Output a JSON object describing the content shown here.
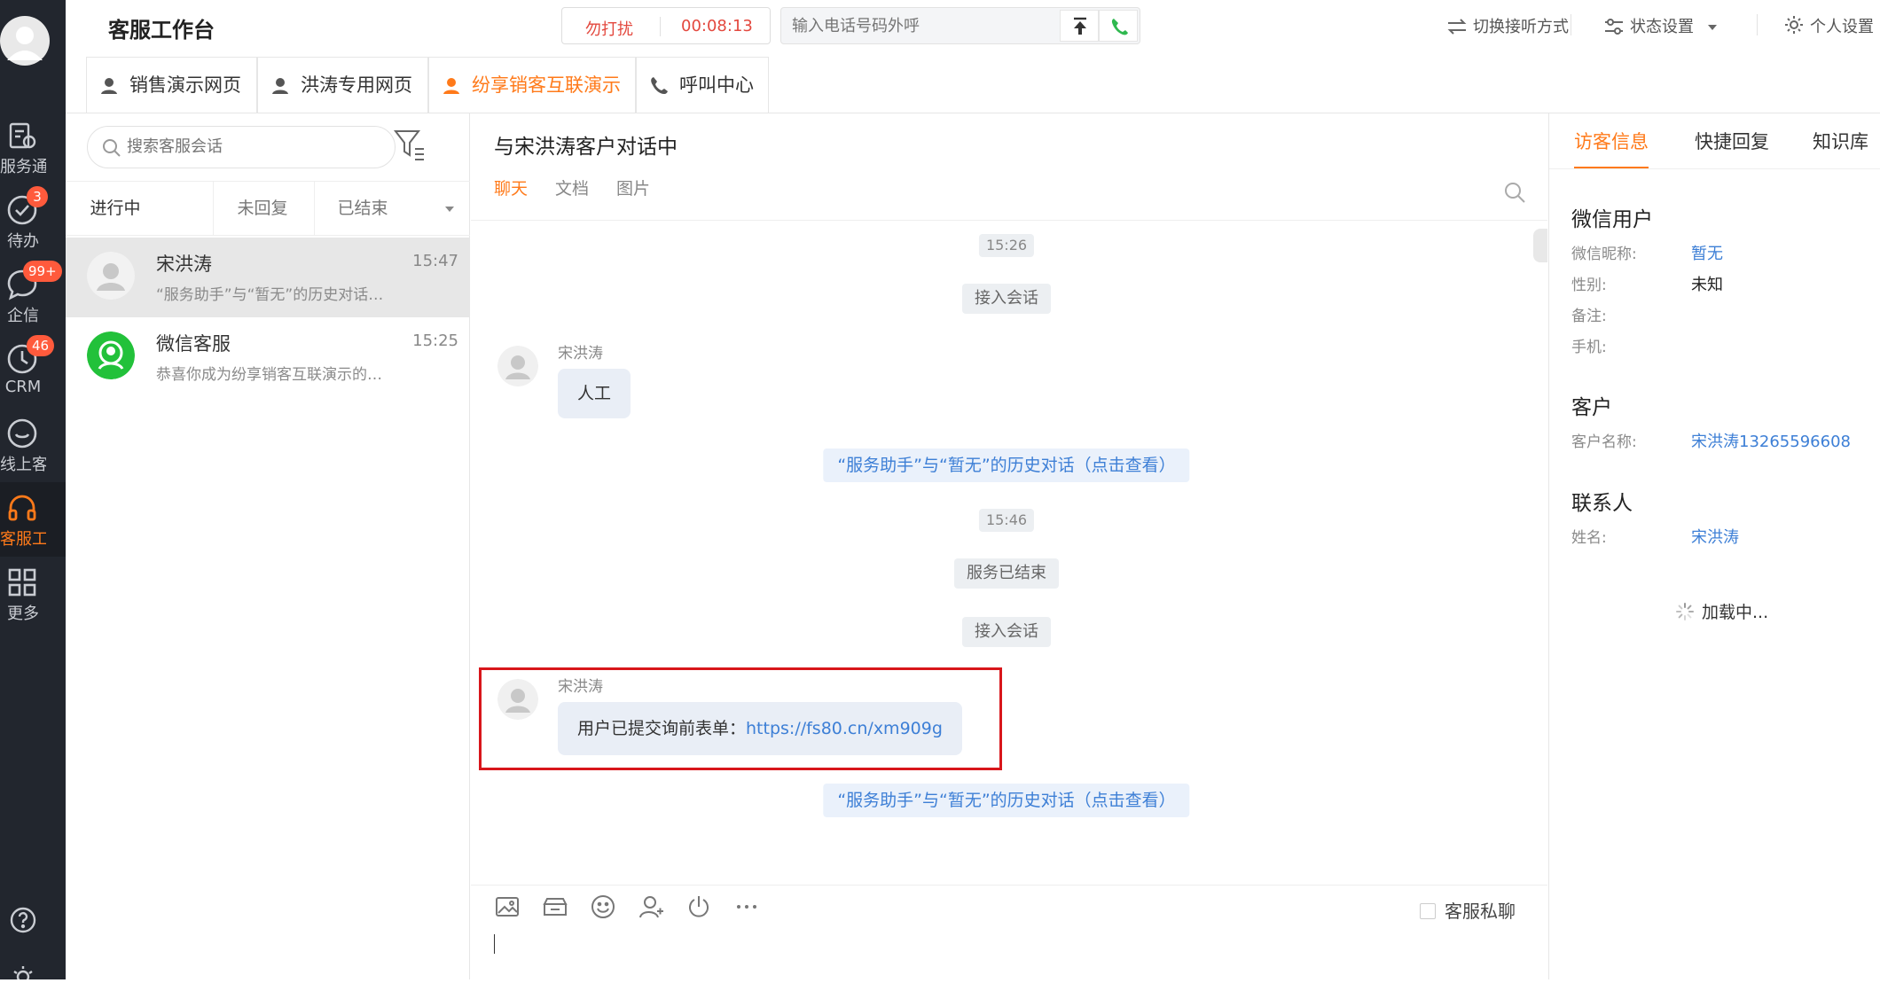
{
  "app": {
    "title": "客服工作台"
  },
  "leftnav": {
    "items": [
      {
        "label": "服务通",
        "icon": "service-icon",
        "badge": ""
      },
      {
        "label": "待办",
        "icon": "todo-check-icon",
        "badge": "3"
      },
      {
        "label": "企信",
        "icon": "chat-bubble-icon",
        "badge": "99+"
      },
      {
        "label": "CRM",
        "icon": "crm-clock-icon",
        "badge": "46"
      },
      {
        "label": "线上客服",
        "icon": "smile-chat-icon",
        "badge": ""
      },
      {
        "label": "客服工…",
        "icon": "headset-icon",
        "badge": ""
      },
      {
        "label": "更多",
        "icon": "grid-icon",
        "badge": ""
      }
    ]
  },
  "topbar": {
    "dnd_label": "勿打扰",
    "timer": "00:08:13",
    "call_placeholder": "输入电话号码外呼",
    "switch_mode": "切换接听方式",
    "status": "状态设置",
    "personal": "个人设置"
  },
  "tabs": [
    {
      "label": "销售演示网页",
      "active": false
    },
    {
      "label": "洪涛专用网页",
      "active": false
    },
    {
      "label": "纷享销客互联演示",
      "active": true
    },
    {
      "label": "呼叫中心",
      "active": false
    }
  ],
  "convlist": {
    "search_placeholder": "搜索客服会话",
    "tabs": [
      "进行中",
      "未回复",
      "已结束"
    ],
    "items": [
      {
        "name": "宋洪涛",
        "time": "15:47",
        "preview": "“服务助手”与“暂无”的历史对话（点击查看）"
      },
      {
        "name": "微信客服",
        "time": "15:25",
        "preview": "恭喜你成为纷享销客互联演示的客户"
      }
    ]
  },
  "chat": {
    "title": "与宋洪涛客户对话中",
    "tabs": [
      "聊天",
      "文档",
      "图片"
    ],
    "time1": "15:26",
    "join1": "接入会话",
    "sender": "宋洪涛",
    "msg1": "人工",
    "history_link": "“服务助手”与“暂无”的历史对话（点击查看）",
    "time2": "15:46",
    "ended": "服务已结束",
    "join2": "接入会话",
    "msg2_prefix": "用户已提交询前表单：",
    "msg2_url": "https://fs80.cn/xm909g",
    "private_chat": "客服私聊"
  },
  "right": {
    "tabs": [
      "访客信息",
      "快捷回复",
      "知识库"
    ],
    "wechat_title": "微信用户",
    "nickname_k": "微信昵称:",
    "nickname_v": "暂无",
    "gender_k": "性别:",
    "gender_v": "未知",
    "remark_k": "备注:",
    "phone_k": "手机:",
    "customer_title": "客户",
    "customer_k": "客户名称:",
    "customer_v": "宋洪涛13265596608",
    "contact_title": "联系人",
    "contact_k": "姓名:",
    "contact_v": "宋洪涛",
    "loading": "加载中..."
  },
  "colors": {
    "accent": "#ff7a1a",
    "link": "#3d7fd6",
    "nav_bg": "#22262e",
    "badge": "#ff5a3c",
    "highlight": "#d8161b"
  }
}
